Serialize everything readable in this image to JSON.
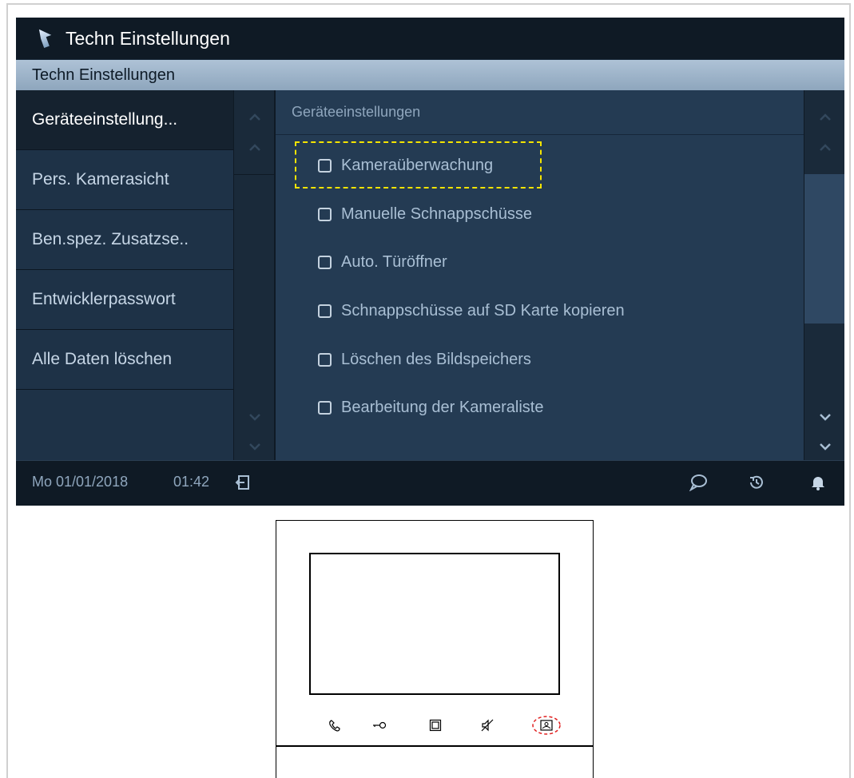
{
  "header": {
    "title": "Techn Einstellungen",
    "subtitle": "Techn Einstellungen"
  },
  "sidebar": {
    "items": [
      {
        "label": "Geräteeinstellung...",
        "active": true
      },
      {
        "label": "Pers. Kamerasicht"
      },
      {
        "label": "Ben.spez. Zusatzse.."
      },
      {
        "label": "Entwicklerpasswort"
      },
      {
        "label": "Alle Daten löschen"
      }
    ]
  },
  "main": {
    "section_title": "Geräteeinstellungen",
    "options": [
      {
        "label": "Kameraüberwachung",
        "checked": false,
        "highlighted": true
      },
      {
        "label": "Manuelle Schnappschüsse",
        "checked": false
      },
      {
        "label": "Auto. Türöffner",
        "checked": false
      },
      {
        "label": "Schnappschüsse auf SD Karte kopieren",
        "checked": false
      },
      {
        "label": "Löschen des Bildspeichers",
        "checked": false
      },
      {
        "label": "Bearbeitung der Kameraliste",
        "checked": false
      }
    ]
  },
  "status": {
    "date": "Mo 01/01/2018",
    "time": "01:42",
    "icons": [
      "exit-icon",
      "message-icon",
      "history-icon",
      "bell-icon"
    ]
  },
  "device": {
    "buttons": [
      "phone-icon",
      "key-icon",
      "square-icon",
      "mute-icon",
      "camera-surveillance-icon"
    ],
    "highlighted_button": "camera-surveillance-icon"
  },
  "colors": {
    "highlight": "#f5e400",
    "device_highlight": "#e02020",
    "background": "#1a2a3a",
    "text": "#a9bfd4"
  }
}
